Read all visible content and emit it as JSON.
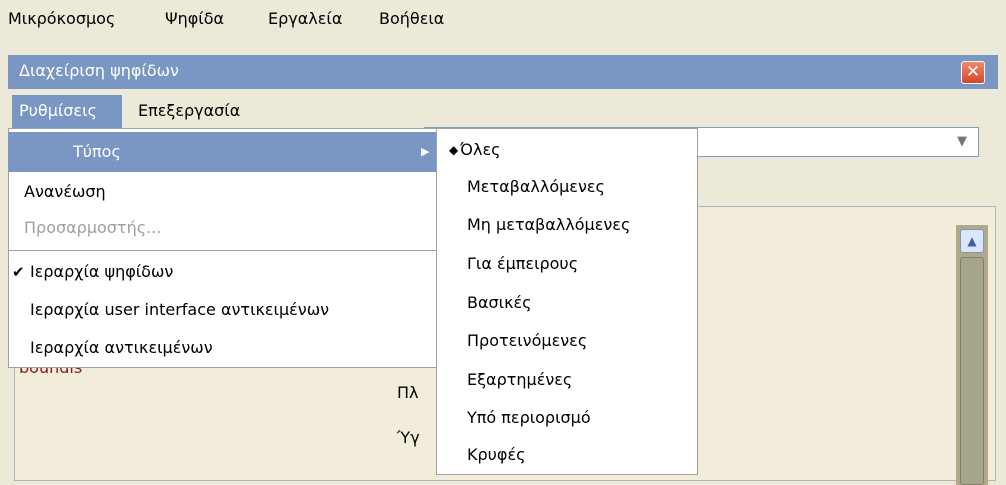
{
  "menubar": {
    "items": [
      "Μικρόκοσμος",
      "Ψηφίδα",
      "Εργαλεία",
      "Βοήθεια"
    ]
  },
  "frame": {
    "title": "Διαχείριση ψηφίδων",
    "close_icon": "close-icon",
    "menus": [
      "Ρυθμίσεις",
      "Επεξεργασία"
    ]
  },
  "settings_menu": {
    "items": [
      {
        "label": "Τύπος",
        "has_submenu": true,
        "state": "highlighted"
      },
      {
        "label": "Ανανέωση",
        "state": "normal"
      },
      {
        "label": "Προσαρμοστής...",
        "state": "disabled"
      },
      {
        "label": "Ιεραρχία ψηφίδων",
        "state": "checked"
      },
      {
        "label": "Ιεραρχία user interface αντικειμένων",
        "state": "normal"
      },
      {
        "label": "Ιεραρχία αντικειμένων",
        "state": "normal"
      }
    ],
    "submenu_arrow_icon": "chevron-right-icon",
    "check_icon": "check-icon"
  },
  "type_submenu": {
    "selected_marker": "◆",
    "items": [
      {
        "label": "Όλες",
        "selected": true
      },
      {
        "label": "Μεταβαλλόμενες"
      },
      {
        "label": "Μη μεταβαλλόμενες"
      },
      {
        "label": "Για έμπειρους"
      },
      {
        "label": "Βασικές"
      },
      {
        "label": "Προτεινόμενες"
      },
      {
        "label": "Εξαρτημένες"
      },
      {
        "label": "Υπό περιορισμό"
      },
      {
        "label": "Κρυφές"
      }
    ]
  },
  "background": {
    "partial_red_text": "boundis",
    "text_1": "Πλ",
    "text_2": "Ύγ"
  },
  "colors": {
    "selection": "#7A96C2",
    "background": "#ECE9D8",
    "disabled_text": "#A0A0A0",
    "accent_red": "#8A1A28"
  }
}
